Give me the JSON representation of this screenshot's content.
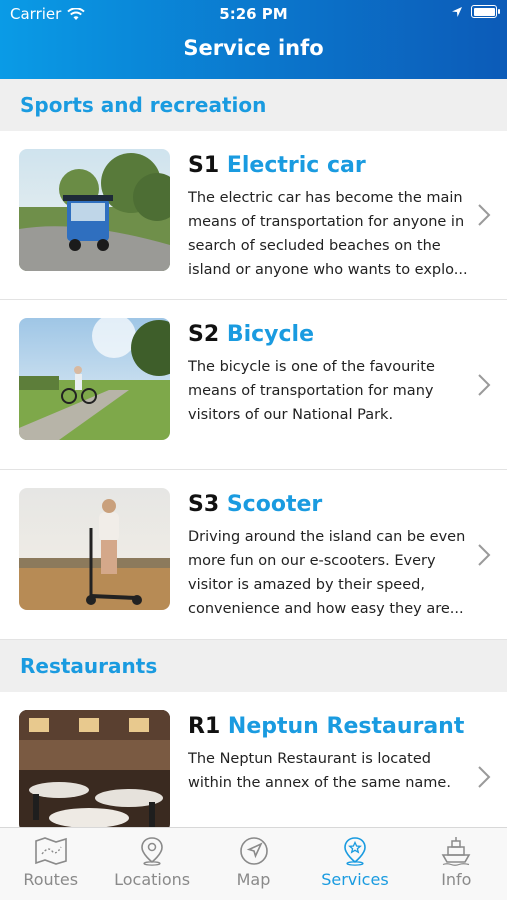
{
  "status": {
    "carrier": "Carrier",
    "time": "5:26 PM"
  },
  "header": {
    "title": "Service info"
  },
  "sections": [
    {
      "title": "Sports and recreation"
    },
    {
      "title": "Restaurants"
    }
  ],
  "items": [
    {
      "code": "S1",
      "name": "Electric car",
      "description": "The electric car has become the main means of transportation for anyone in search of secluded beaches on the island or anyone who wants to explo..."
    },
    {
      "code": "S2",
      "name": "Bicycle",
      "description": "The bicycle is one of the favourite means of transportation for many visitors of our National Park."
    },
    {
      "code": "S3",
      "name": "Scooter",
      "description": "Driving around the island can be even more fun on our e-scooters. Every visitor is amazed by their speed, convenience and how easy they are..."
    },
    {
      "code": "R1",
      "name": "Neptun Restaurant",
      "description": "The Neptun Restaurant is located within the annex of the same name."
    }
  ],
  "tabs": [
    {
      "label": "Routes",
      "icon": "map-icon"
    },
    {
      "label": "Locations",
      "icon": "location-pin-icon"
    },
    {
      "label": "Map",
      "icon": "compass-icon"
    },
    {
      "label": "Services",
      "icon": "services-star-icon",
      "active": true
    },
    {
      "label": "Info",
      "icon": "ship-icon"
    }
  ],
  "colors": {
    "accent": "#1a9be0",
    "header_start": "#0a9be6",
    "header_end": "#0c5bb8"
  }
}
